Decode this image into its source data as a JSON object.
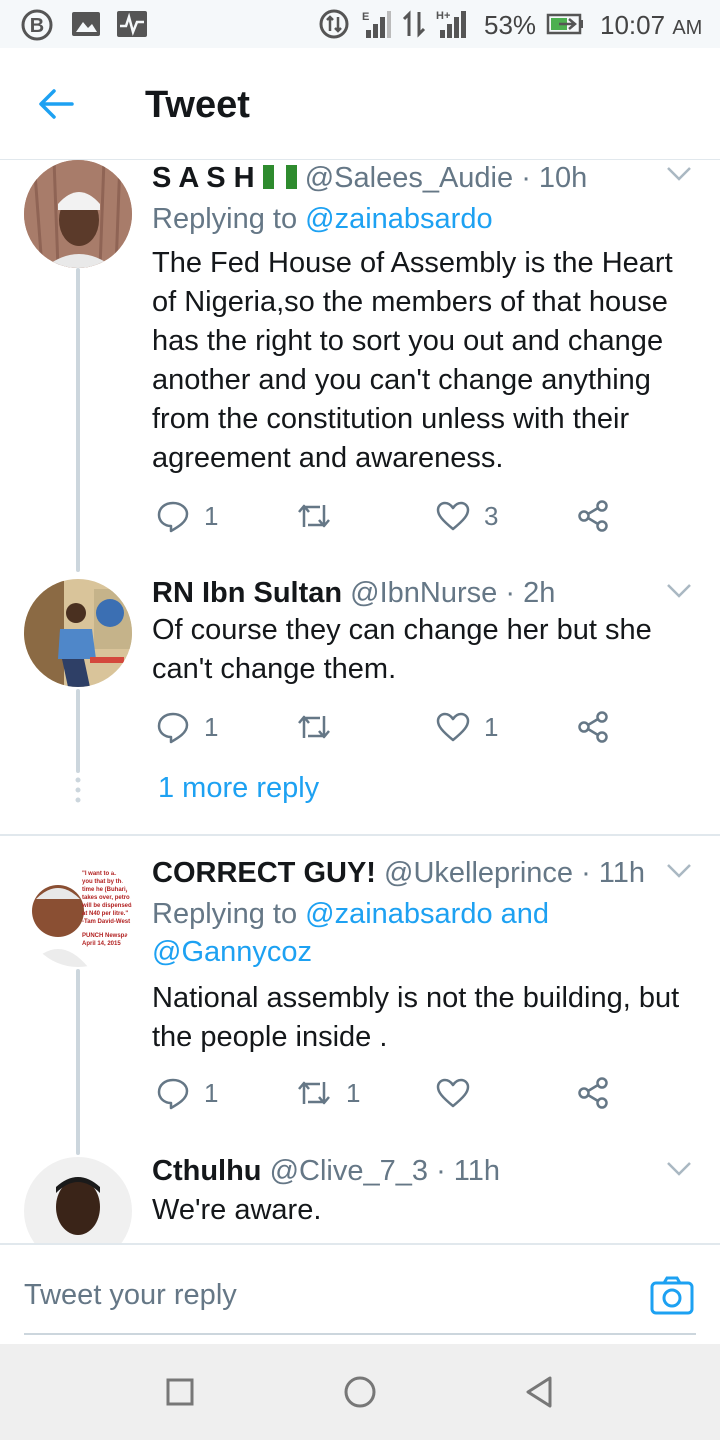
{
  "status_bar": {
    "battery_percent": "53%",
    "time": "10:07",
    "ampm": "AM",
    "network_h": "H+"
  },
  "header": {
    "title": "Tweet",
    "back_icon": "arrow-left-icon"
  },
  "tweets": [
    {
      "name": "S A S H",
      "flag": "nigeria-flag-icon",
      "handle": "@Salees_Audie",
      "time": "· 10h",
      "replying_prefix": "Replying to",
      "replying_to": "@zainabsardo",
      "body": "The Fed House of Assembly is the Heart of Nigeria,so the members of that house has the right to sort you out and change another and you can't change anything from the constitution unless with their agreement and awareness.",
      "reply_count": "1",
      "retweet_count": "",
      "like_count": "3"
    },
    {
      "name": "RN Ibn Sultan",
      "handle": "@IbnNurse",
      "time": "· 2h",
      "body": "Of course they can change her but she can't change them.",
      "reply_count": "1",
      "retweet_count": "",
      "like_count": "1"
    },
    {
      "name": "CORRECT GUY!",
      "handle": "@Ukelleprince",
      "time": "· 11h",
      "replying_prefix": "Replying to",
      "replying_to": "@zainabsardo and",
      "replying_to_2": "@Gannycoz",
      "body": "National assembly is not the building, but the people inside .",
      "reply_count": "1",
      "retweet_count": "1",
      "like_count": "",
      "avatar_text": "\"I want to ass. you that by the time he (Buhari) takes over, petrol will be dispensed at N40 per litre.\" -Tam David-West PUNCH Newspaper April 14, 2015"
    },
    {
      "name": "Cthulhu",
      "handle": "@Clive_7_3",
      "time": "· 11h",
      "body": "We're aware."
    }
  ],
  "more_replies": "1 more reply",
  "reply_bar": {
    "placeholder": "Tweet your reply",
    "camera_icon": "camera-icon"
  },
  "colors": {
    "accent": "#1da1f2",
    "text": "#14171a",
    "secondary": "#657786",
    "divider": "#e1e8ed"
  }
}
